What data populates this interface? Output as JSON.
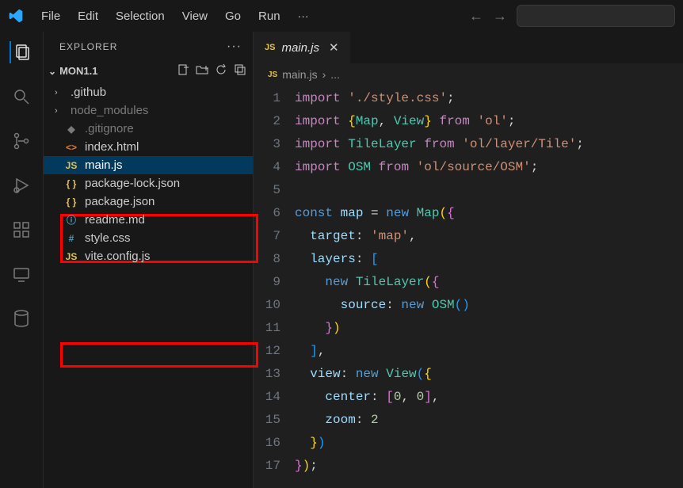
{
  "menu": [
    "File",
    "Edit",
    "Selection",
    "View",
    "Go",
    "Run"
  ],
  "explorer": {
    "title": "EXPLORER",
    "folder": "MON1.1",
    "items": [
      {
        "name": ".github",
        "type": "folder",
        "dim": false
      },
      {
        "name": "node_modules",
        "type": "folder",
        "dim": true
      },
      {
        "name": ".gitignore",
        "type": "file",
        "icon": "git",
        "dim": true
      },
      {
        "name": "index.html",
        "type": "file",
        "icon": "html"
      },
      {
        "name": "main.js",
        "type": "file",
        "icon": "js",
        "selected": true
      },
      {
        "name": "package-lock.json",
        "type": "file",
        "icon": "json"
      },
      {
        "name": "package.json",
        "type": "file",
        "icon": "json"
      },
      {
        "name": "readme.md",
        "type": "file",
        "icon": "info"
      },
      {
        "name": "style.css",
        "type": "file",
        "icon": "css"
      },
      {
        "name": "vite.config.js",
        "type": "file",
        "icon": "js"
      }
    ]
  },
  "tab": {
    "icon": "JS",
    "label": "main.js"
  },
  "breadcrumb": {
    "icon": "JS",
    "file": "main.js",
    "sep": "›",
    "rest": "..."
  },
  "code": {
    "lines": [
      {
        "n": 1,
        "html": "<span class='kw-import'>import</span> <span class='str'>'./style.css'</span>;"
      },
      {
        "n": 2,
        "html": "<span class='kw-import'>import</span> <span class='punct-yellow'>{</span><span class='cls'>Map</span>, <span class='cls'>View</span><span class='punct-yellow'>}</span> <span class='kw-from'>from</span> <span class='str'>'ol'</span>;"
      },
      {
        "n": 3,
        "html": "<span class='kw-import'>import</span> <span class='cls'>TileLayer</span> <span class='kw-from'>from</span> <span class='str'>'ol/layer/Tile'</span>;"
      },
      {
        "n": 4,
        "html": "<span class='kw-import'>import</span> <span class='cls'>OSM</span> <span class='kw-from'>from</span> <span class='str'>'ol/source/OSM'</span>;"
      },
      {
        "n": 5,
        "html": ""
      },
      {
        "n": 6,
        "html": "<span class='kw-const'>const</span> <span class='var'>map</span> = <span class='kw-new'>new</span> <span class='cls'>Map</span><span class='punct-yellow'>(</span><span class='punct-purple'>{</span>"
      },
      {
        "n": 7,
        "html": "  <span class='prop'>target</span>: <span class='str'>'map'</span>,"
      },
      {
        "n": 8,
        "html": "  <span class='prop'>layers</span>: <span class='punct-blue'>[</span>"
      },
      {
        "n": 9,
        "html": "    <span class='kw-new'>new</span> <span class='cls'>TileLayer</span><span class='punct-yellow'>(</span><span class='punct-purple'>{</span>"
      },
      {
        "n": 10,
        "html": "      <span class='prop'>source</span>: <span class='kw-new'>new</span> <span class='cls'>OSM</span><span class='punct-blue'>()</span>"
      },
      {
        "n": 11,
        "html": "    <span class='punct-purple'>}</span><span class='punct-yellow'>)</span>"
      },
      {
        "n": 12,
        "html": "  <span class='punct-blue'>]</span>,"
      },
      {
        "n": 13,
        "html": "  <span class='prop'>view</span>: <span class='kw-new'>new</span> <span class='cls'>View</span><span class='punct-blue'>(</span><span class='punct-yellow'>{</span>"
      },
      {
        "n": 14,
        "html": "    <span class='prop'>center</span>: <span class='punct-purple'>[</span><span class='num'>0</span>, <span class='num'>0</span><span class='punct-purple'>]</span>,"
      },
      {
        "n": 15,
        "html": "    <span class='prop'>zoom</span>: <span class='num'>2</span>"
      },
      {
        "n": 16,
        "html": "  <span class='punct-yellow'>}</span><span class='punct-blue'>)</span>"
      },
      {
        "n": 17,
        "html": "<span class='punct-purple'>}</span><span class='punct-yellow'>)</span>;"
      }
    ]
  }
}
